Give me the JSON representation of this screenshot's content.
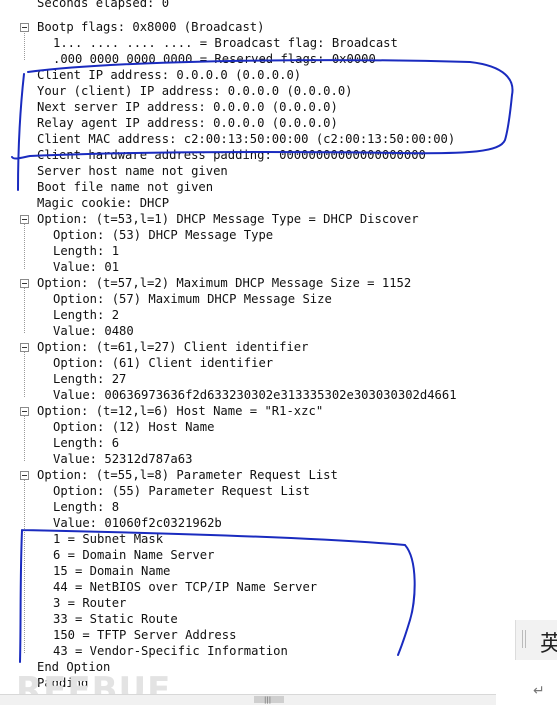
{
  "packet_details": {
    "lines": [
      "Seconds elapsed: 0",
      "Bootp flags: 0x8000 (Broadcast)",
      "1... .... .... .... = Broadcast flag: Broadcast",
      ".000 0000 0000 0000 = Reserved flags: 0x0000",
      "Client IP address: 0.0.0.0 (0.0.0.0)",
      "Your (client) IP address: 0.0.0.0 (0.0.0.0)",
      "Next server IP address: 0.0.0.0 (0.0.0.0)",
      "Relay agent IP address: 0.0.0.0 (0.0.0.0)",
      "Client MAC address: c2:00:13:50:00:00 (c2:00:13:50:00:00)",
      "Client hardware address padding: 00000000000000000000",
      "Server host name not given",
      "Boot file name not given",
      "Magic cookie: DHCP",
      "Option: (t=53,l=1) DHCP Message Type = DHCP Discover",
      "Option: (53) DHCP Message Type",
      "Length: 1",
      "Value: 01",
      "Option: (t=57,l=2) Maximum DHCP Message Size = 1152",
      "Option: (57) Maximum DHCP Message Size",
      "Length: 2",
      "Value: 0480",
      "Option: (t=61,l=27) Client identifier",
      "Option: (61) Client identifier",
      "Length: 27",
      "Value: 00636973636f2d633230302e313335302e303030302d4661",
      "Option: (t=12,l=6) Host Name = \"R1-xzc\"",
      "Option: (12) Host Name",
      "Length: 6",
      "Value: 52312d787a63",
      "Option: (t=55,l=8) Parameter Request List",
      "Option: (55) Parameter Request List",
      "Length: 8",
      "Value: 01060f2c0321962b",
      "1 = Subnet Mask",
      "6 = Domain Name Server",
      "15 = Domain Name",
      "44 = NetBIOS over TCP/IP Name Server",
      "3 = Router",
      "33 = Static Route",
      "150 = TFTP Server Address",
      "43 = Vendor-Specific Information",
      "End Option",
      "Padding"
    ]
  },
  "ime_indicator": {
    "label": "英"
  },
  "watermark": {
    "text": "REEBUF"
  },
  "colors": {
    "annotation": "#1a2bbf",
    "text": "#111111",
    "background": "#ffffff"
  },
  "icons": {
    "toggle": "collapse-toggle-icon",
    "enter": "enter-arrow-icon",
    "grip": "scroll-grip-icon"
  }
}
